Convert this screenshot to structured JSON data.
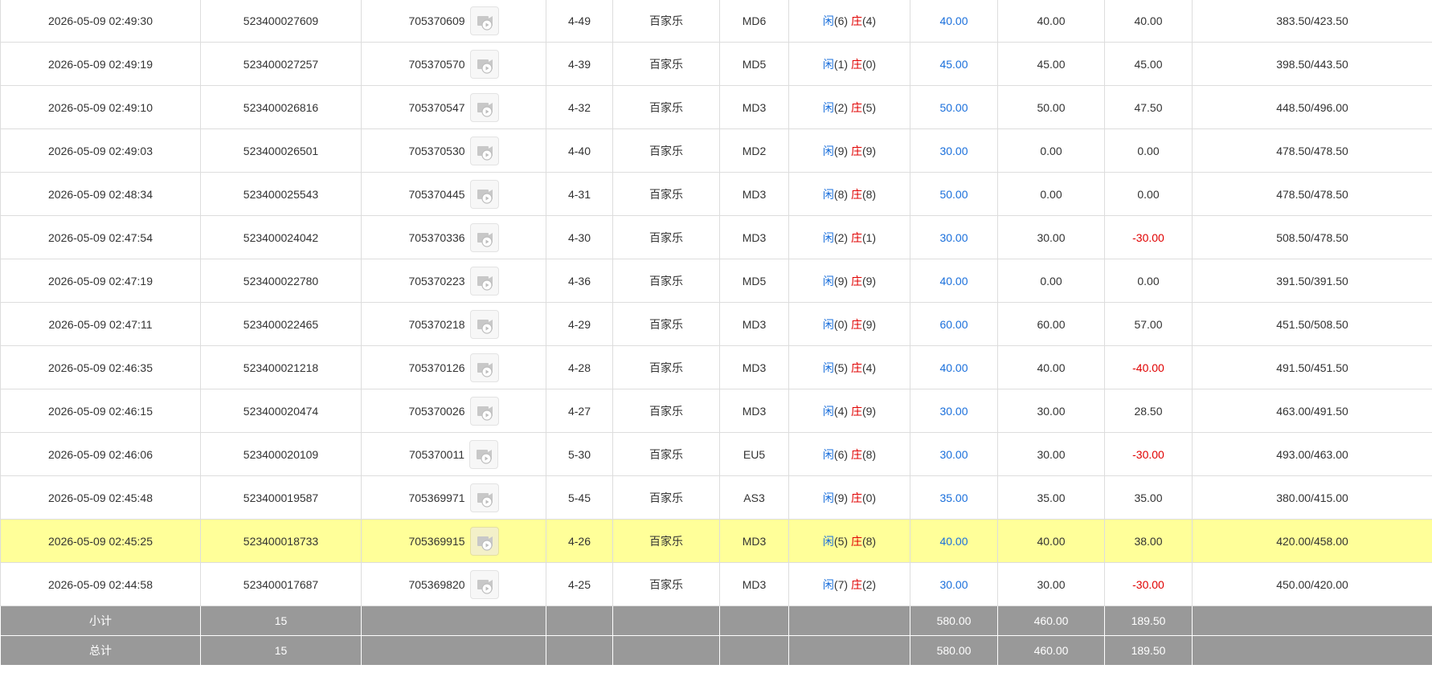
{
  "rows": [
    {
      "time": "2026-05-09 02:49:30",
      "order_id": "523400027609",
      "round_id": "705370609",
      "table": "4-49",
      "game": "百家乐",
      "desk": "MD6",
      "xian": "闲",
      "xian_pts": "(6)",
      "zhuang": "庄",
      "zhuang_pts": "(4)",
      "bet": "40.00",
      "valid": "40.00",
      "win": "40.00",
      "win_neg": false,
      "balance": "383.50/423.50",
      "highlight": false
    },
    {
      "time": "2026-05-09 02:49:19",
      "order_id": "523400027257",
      "round_id": "705370570",
      "table": "4-39",
      "game": "百家乐",
      "desk": "MD5",
      "xian": "闲",
      "xian_pts": "(1)",
      "zhuang": "庄",
      "zhuang_pts": "(0)",
      "bet": "45.00",
      "valid": "45.00",
      "win": "45.00",
      "win_neg": false,
      "balance": "398.50/443.50",
      "highlight": false
    },
    {
      "time": "2026-05-09 02:49:10",
      "order_id": "523400026816",
      "round_id": "705370547",
      "table": "4-32",
      "game": "百家乐",
      "desk": "MD3",
      "xian": "闲",
      "xian_pts": "(2)",
      "zhuang": "庄",
      "zhuang_pts": "(5)",
      "bet": "50.00",
      "valid": "50.00",
      "win": "47.50",
      "win_neg": false,
      "balance": "448.50/496.00",
      "highlight": false
    },
    {
      "time": "2026-05-09 02:49:03",
      "order_id": "523400026501",
      "round_id": "705370530",
      "table": "4-40",
      "game": "百家乐",
      "desk": "MD2",
      "xian": "闲",
      "xian_pts": "(9)",
      "zhuang": "庄",
      "zhuang_pts": "(9)",
      "bet": "30.00",
      "valid": "0.00",
      "win": "0.00",
      "win_neg": false,
      "balance": "478.50/478.50",
      "highlight": false
    },
    {
      "time": "2026-05-09 02:48:34",
      "order_id": "523400025543",
      "round_id": "705370445",
      "table": "4-31",
      "game": "百家乐",
      "desk": "MD3",
      "xian": "闲",
      "xian_pts": "(8)",
      "zhuang": "庄",
      "zhuang_pts": "(8)",
      "bet": "50.00",
      "valid": "0.00",
      "win": "0.00",
      "win_neg": false,
      "balance": "478.50/478.50",
      "highlight": false
    },
    {
      "time": "2026-05-09 02:47:54",
      "order_id": "523400024042",
      "round_id": "705370336",
      "table": "4-30",
      "game": "百家乐",
      "desk": "MD3",
      "xian": "闲",
      "xian_pts": "(2)",
      "zhuang": "庄",
      "zhuang_pts": "(1)",
      "bet": "30.00",
      "valid": "30.00",
      "win": "-30.00",
      "win_neg": true,
      "balance": "508.50/478.50",
      "highlight": false
    },
    {
      "time": "2026-05-09 02:47:19",
      "order_id": "523400022780",
      "round_id": "705370223",
      "table": "4-36",
      "game": "百家乐",
      "desk": "MD5",
      "xian": "闲",
      "xian_pts": "(9)",
      "zhuang": "庄",
      "zhuang_pts": "(9)",
      "bet": "40.00",
      "valid": "0.00",
      "win": "0.00",
      "win_neg": false,
      "balance": "391.50/391.50",
      "highlight": false
    },
    {
      "time": "2026-05-09 02:47:11",
      "order_id": "523400022465",
      "round_id": "705370218",
      "table": "4-29",
      "game": "百家乐",
      "desk": "MD3",
      "xian": "闲",
      "xian_pts": "(0)",
      "zhuang": "庄",
      "zhuang_pts": "(9)",
      "bet": "60.00",
      "valid": "60.00",
      "win": "57.00",
      "win_neg": false,
      "balance": "451.50/508.50",
      "highlight": false
    },
    {
      "time": "2026-05-09 02:46:35",
      "order_id": "523400021218",
      "round_id": "705370126",
      "table": "4-28",
      "game": "百家乐",
      "desk": "MD3",
      "xian": "闲",
      "xian_pts": "(5)",
      "zhuang": "庄",
      "zhuang_pts": "(4)",
      "bet": "40.00",
      "valid": "40.00",
      "win": "-40.00",
      "win_neg": true,
      "balance": "491.50/451.50",
      "highlight": false
    },
    {
      "time": "2026-05-09 02:46:15",
      "order_id": "523400020474",
      "round_id": "705370026",
      "table": "4-27",
      "game": "百家乐",
      "desk": "MD3",
      "xian": "闲",
      "xian_pts": "(4)",
      "zhuang": "庄",
      "zhuang_pts": "(9)",
      "bet": "30.00",
      "valid": "30.00",
      "win": "28.50",
      "win_neg": false,
      "balance": "463.00/491.50",
      "highlight": false
    },
    {
      "time": "2026-05-09 02:46:06",
      "order_id": "523400020109",
      "round_id": "705370011",
      "table": "5-30",
      "game": "百家乐",
      "desk": "EU5",
      "xian": "闲",
      "xian_pts": "(6)",
      "zhuang": "庄",
      "zhuang_pts": "(8)",
      "bet": "30.00",
      "valid": "30.00",
      "win": "-30.00",
      "win_neg": true,
      "balance": "493.00/463.00",
      "highlight": false
    },
    {
      "time": "2026-05-09 02:45:48",
      "order_id": "523400019587",
      "round_id": "705369971",
      "table": "5-45",
      "game": "百家乐",
      "desk": "AS3",
      "xian": "闲",
      "xian_pts": "(9)",
      "zhuang": "庄",
      "zhuang_pts": "(0)",
      "bet": "35.00",
      "valid": "35.00",
      "win": "35.00",
      "win_neg": false,
      "balance": "380.00/415.00",
      "highlight": false
    },
    {
      "time": "2026-05-09 02:45:25",
      "order_id": "523400018733",
      "round_id": "705369915",
      "table": "4-26",
      "game": "百家乐",
      "desk": "MD3",
      "xian": "闲",
      "xian_pts": "(5)",
      "zhuang": "庄",
      "zhuang_pts": "(8)",
      "bet": "40.00",
      "valid": "40.00",
      "win": "38.00",
      "win_neg": false,
      "balance": "420.00/458.00",
      "highlight": true
    },
    {
      "time": "2026-05-09 02:44:58",
      "order_id": "523400017687",
      "round_id": "705369820",
      "table": "4-25",
      "game": "百家乐",
      "desk": "MD3",
      "xian": "闲",
      "xian_pts": "(7)",
      "zhuang": "庄",
      "zhuang_pts": "(2)",
      "bet": "30.00",
      "valid": "30.00",
      "win": "-30.00",
      "win_neg": true,
      "balance": "450.00/420.00",
      "highlight": false
    }
  ],
  "subtotal": {
    "label": "小计",
    "count": "15",
    "bet": "580.00",
    "valid": "460.00",
    "win": "189.50"
  },
  "total": {
    "label": "总计",
    "count": "15",
    "bet": "580.00",
    "valid": "460.00",
    "win": "189.50"
  },
  "icons": {
    "replay": "video-replay-icon"
  },
  "colors": {
    "xian": "#1a6fdb",
    "zhuang": "#e00000",
    "highlight": "#ffff99",
    "total_bg": "#999999",
    "negative": "#e00000",
    "bet": "#1a6fdb"
  }
}
